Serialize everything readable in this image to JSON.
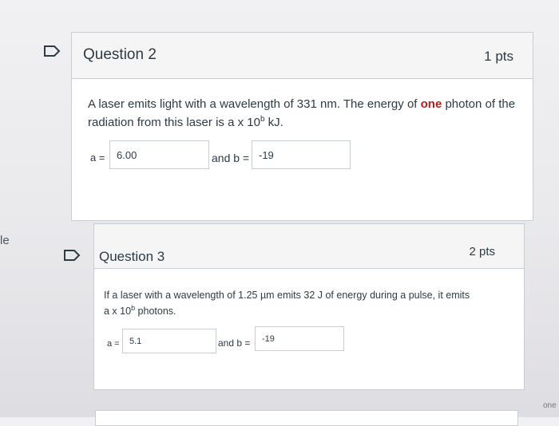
{
  "sidebar": {
    "left_fragment": "le",
    "right_fragment": "one"
  },
  "questions": [
    {
      "title": "Question 2",
      "points": "1 pts",
      "text_before_bold": "A laser emits light with a wavelength of 331 nm. The energy of ",
      "text_bold": "one",
      "text_after_bold": " photon of the",
      "text_line2_a": "radiation from this laser is a x 10",
      "text_line2_sup": "b",
      "text_line2_b": " kJ.",
      "a_label": "a =",
      "a_value": "6.00",
      "b_label": "and b =",
      "b_value": "-19"
    },
    {
      "title": "Question 3",
      "points": "2 pts",
      "text_line1": "If a laser with a wavelength of 1.25 µm emits 32 J of energy during a pulse, it emits",
      "text_line2_a": "a x 10",
      "text_line2_sup": "b",
      "text_line2_b": " photons.",
      "a_label": "a =",
      "a_value": "5.1",
      "b_label": "and b =",
      "b_value": "-19"
    }
  ],
  "colors": {
    "accent_bold": "#b41e1e",
    "border": "#c7cdd1",
    "header_bg": "#f5f5f5"
  }
}
